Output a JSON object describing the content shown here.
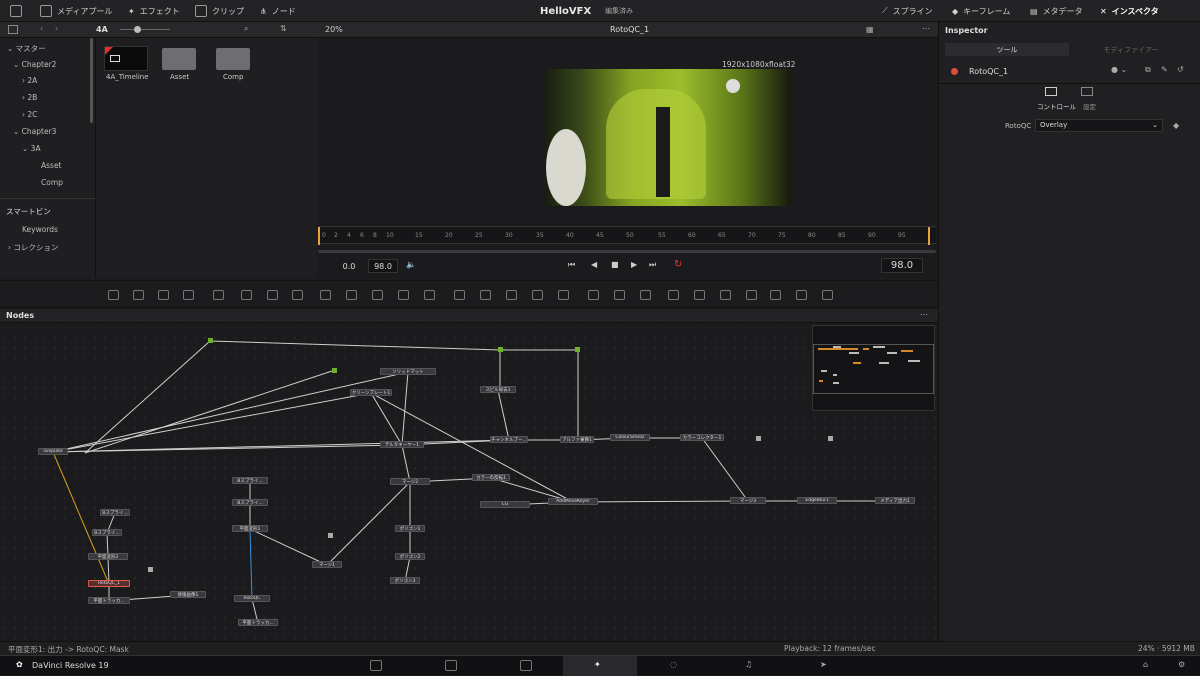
{
  "topbar": {
    "media_pool": "メディアプール",
    "effects": "エフェクト",
    "clips": "クリップ",
    "nodes": "ノード",
    "project": "HelloVFX",
    "status": "編集済み",
    "spline": "スプライン",
    "keyframes": "キーフレーム",
    "metadata": "メタデータ",
    "inspector": "インスペクタ"
  },
  "bar2": {
    "bin": "4A",
    "zoom": "20%",
    "viewer_clip": "RotoQC_1"
  },
  "tree": {
    "master": "マスター",
    "ch2": "Chapter2",
    "a2": "2A",
    "b2": "2B",
    "c2": "2C",
    "ch3": "Chapter3",
    "a3": "3A",
    "asset": "Asset",
    "comp": "Comp"
  },
  "media": {
    "items": [
      {
        "label": "4A_Timeline"
      },
      {
        "label": "Asset"
      },
      {
        "label": "Comp"
      }
    ]
  },
  "smart": {
    "title": "スマートビン",
    "keywords": "Keywords",
    "collections": "コレクション"
  },
  "viewer": {
    "resolution": "1920x1080xfloat32",
    "current_in": "0.0",
    "current_out": "98.0",
    "frame": "98.0"
  },
  "ruler": [
    "0",
    "2",
    "4",
    "6",
    "8",
    "10",
    "15",
    "20",
    "25",
    "30",
    "35",
    "40",
    "45",
    "50",
    "55",
    "60",
    "65",
    "70",
    "75",
    "80",
    "85",
    "90",
    "95"
  ],
  "nodes": {
    "title": "Nodes",
    "list": [
      {
        "id": "liveplate",
        "label": "liveplate"
      },
      {
        "id": "solid",
        "label": "ソリッドマット"
      },
      {
        "id": "clean",
        "label": "クリーンプレート1"
      },
      {
        "id": "delta",
        "label": "デルタキーヤー1"
      },
      {
        "id": "spill",
        "label": "スピル除去1"
      },
      {
        "id": "channel",
        "label": "チャンネルブー..."
      },
      {
        "id": "alpha",
        "label": "アルファ乗算1"
      },
      {
        "id": "smear",
        "label": "ColourSmear"
      },
      {
        "id": "cc",
        "label": "カラーコレクター1"
      },
      {
        "id": "merge2",
        "label": "マージ2"
      },
      {
        "id": "ccrev",
        "label": "カラーの反転1"
      },
      {
        "id": "cg",
        "label": "CG"
      },
      {
        "id": "addmove",
        "label": "AddMoveKeyer"
      },
      {
        "id": "merge3",
        "label": "マージ3"
      },
      {
        "id": "edge",
        "label": "EdgeBlur1"
      },
      {
        "id": "mediaout",
        "label": "メディア出力1"
      },
      {
        "id": "poly1",
        "label": "ポリゴン1"
      },
      {
        "id": "poly2",
        "label": "ポリゴン2"
      },
      {
        "id": "poly3",
        "label": "ポリゴン3"
      },
      {
        "id": "bs1",
        "label": "Bスプライ..."
      },
      {
        "id": "bs2",
        "label": "Bスプライ..."
      },
      {
        "id": "bs3",
        "label": "Bスプライ..."
      },
      {
        "id": "bs4",
        "label": "Bスプライ..."
      },
      {
        "id": "plane1",
        "label": "平面変形1"
      },
      {
        "id": "plane2",
        "label": "平面変形2"
      },
      {
        "id": "merge1",
        "label": "マージ1"
      },
      {
        "id": "rotoqc1",
        "label": "RotoQC_1"
      },
      {
        "id": "planetrack1",
        "label": "平面トラッカ..."
      },
      {
        "id": "inv1",
        "label": "修復画像1"
      },
      {
        "id": "rotoqc",
        "label": "RotoQC"
      },
      {
        "id": "planetrack2",
        "label": "平面トラッカ..."
      }
    ]
  },
  "status": {
    "left": "平面変形1: 出力 -> RotoQC: Mask",
    "playback": "Playback: 12 frames/sec",
    "memory": "24% · 5912 MB"
  },
  "app": {
    "name": "DaVinci Resolve 19"
  },
  "inspector": {
    "title": "Inspector",
    "tab_tools": "ツール",
    "tab_modifiers": "モディファイアー",
    "node_name": "RotoQC_1",
    "sub_controls": "コントロール",
    "sub_settings": "設定",
    "param_label": "RotoQC",
    "param_value": "Overlay"
  }
}
